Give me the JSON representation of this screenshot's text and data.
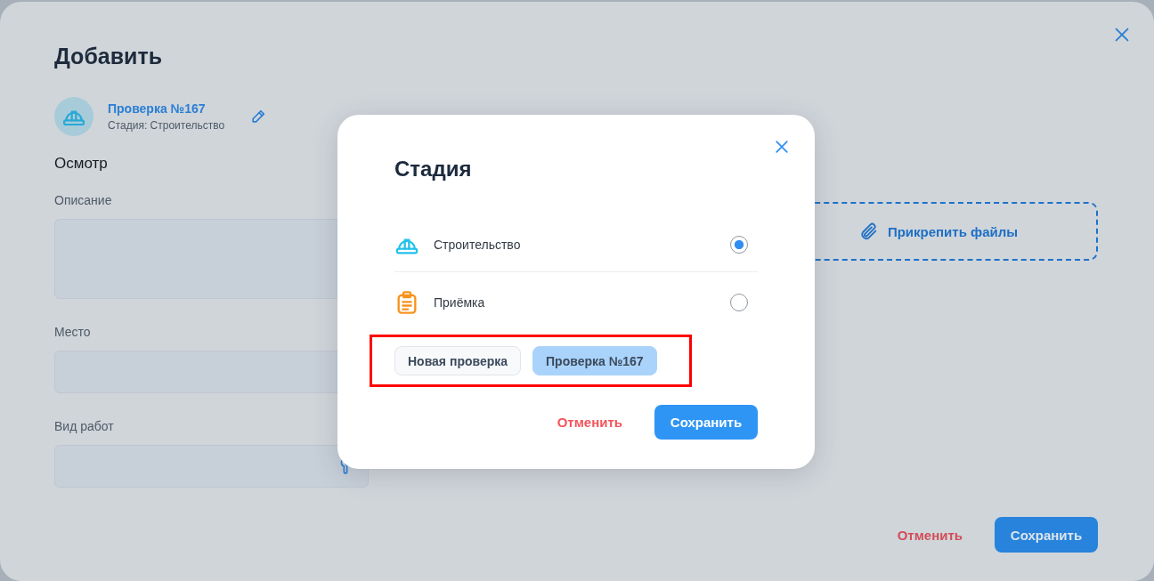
{
  "window": {
    "title": "Добавить"
  },
  "record": {
    "title": "Проверка №167",
    "subtitle": "Стадия: Строительство"
  },
  "section": {
    "title": "Осмотр"
  },
  "fields": [
    {
      "label": "Описание",
      "kind": "textarea"
    },
    {
      "label": "Место",
      "kind": "text"
    },
    {
      "label": "Вид работ",
      "kind": "picker"
    }
  ],
  "attachments": {
    "label": "Прикрепить файлы"
  },
  "actions": [
    {
      "label": "Отменить",
      "kind": "cancel"
    },
    {
      "label": "Сохранить",
      "kind": "save"
    }
  ],
  "stage_dialog": {
    "title": "Стадия",
    "options": [
      {
        "label": "Строительство",
        "kind": "construction",
        "selected": true
      },
      {
        "label": "Приёмка",
        "kind": "acceptance",
        "selected": false
      }
    ],
    "checks": {
      "highlighted": true,
      "items": [
        {
          "label": "Новая проверка",
          "selected": false
        },
        {
          "label": "Проверка №167",
          "selected": true
        }
      ]
    },
    "actions": [
      {
        "label": "Отменить",
        "kind": "cancel"
      },
      {
        "label": "Сохранить",
        "kind": "save"
      }
    ]
  }
}
